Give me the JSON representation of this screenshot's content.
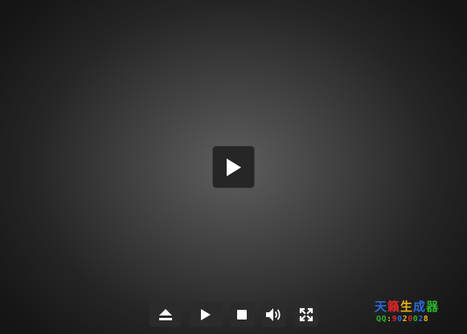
{
  "player": {
    "big_play_icon": "play-icon"
  },
  "controls": [
    {
      "name": "eject-button",
      "icon": "eject-icon"
    },
    {
      "name": "play-button",
      "icon": "play-icon"
    },
    {
      "name": "stop-button",
      "icon": "stop-icon"
    },
    {
      "name": "volume-button",
      "icon": "volume-icon"
    },
    {
      "name": "fullscreen-button",
      "icon": "fullscreen-icon"
    }
  ],
  "watermark": {
    "title_chars": [
      "天",
      "籟",
      "生",
      "成",
      "器"
    ],
    "number": "QQ:9020028",
    "colors": [
      "#2a6bd9",
      "#d9262a",
      "#e8b21a",
      "#2bb52b"
    ]
  }
}
